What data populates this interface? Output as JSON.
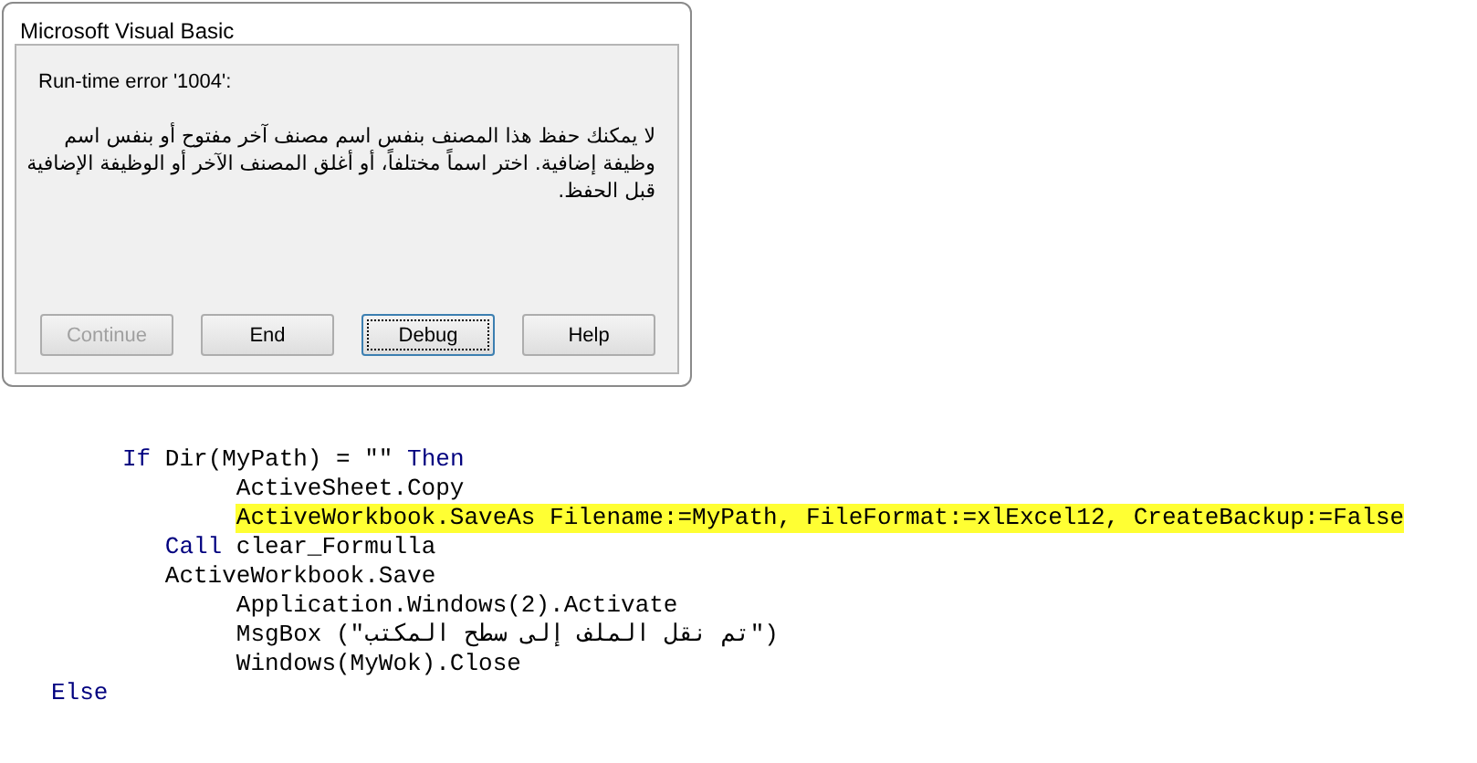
{
  "dialog": {
    "title": "Microsoft Visual Basic",
    "error": "Run-time error '1004':",
    "message": "لا يمكنك حفظ هذا المصنف بنفس اسم مصنف آخر مفتوح أو بنفس اسم وظيفة إضافية. اختر اسماً مختلفاً، أو أغلق المصنف الآخر أو الوظيفة الإضافية قبل الحفظ.",
    "buttons": [
      {
        "label": "Continue",
        "disabled": true,
        "focused": false
      },
      {
        "label": "End",
        "disabled": false,
        "focused": false
      },
      {
        "label": "Debug",
        "disabled": false,
        "focused": true
      },
      {
        "label": "Help",
        "disabled": false,
        "focused": false
      }
    ]
  },
  "code": [
    {
      "highlighted": false,
      "segments": [
        {
          "kind": "keyword",
          "text": "     If"
        },
        {
          "kind": "code",
          "text": " Dir(MyPath) = \"\" "
        },
        {
          "kind": "keyword",
          "text": "Then"
        }
      ]
    },
    {
      "highlighted": false,
      "segments": [
        {
          "kind": "code",
          "text": "             ActiveSheet.Copy"
        }
      ]
    },
    {
      "highlighted": true,
      "segments": [
        {
          "kind": "code",
          "text": "             ActiveWorkbook.SaveAs Filename:=MyPath, FileFormat:=xlExcel12, CreateBackup:=False"
        }
      ]
    },
    {
      "highlighted": false,
      "segments": [
        {
          "kind": "keyword",
          "text": "        Call"
        },
        {
          "kind": "code",
          "text": " clear_Formulla"
        }
      ]
    },
    {
      "highlighted": false,
      "segments": [
        {
          "kind": "code",
          "text": "        ActiveWorkbook.Save"
        }
      ]
    },
    {
      "highlighted": false,
      "segments": [
        {
          "kind": "code",
          "text": "             Application.Windows(2).Activate"
        }
      ]
    },
    {
      "highlighted": false,
      "segments": [
        {
          "kind": "code",
          "text": "             MsgBox (\"تم نقل الملف إلى سطح المكتب\")"
        }
      ]
    },
    {
      "highlighted": false,
      "segments": [
        {
          "kind": "code",
          "text": "             Windows(MyWok).Close"
        }
      ]
    },
    {
      "highlighted": false,
      "segments": [
        {
          "kind": "keyword",
          "text": "Else"
        }
      ]
    }
  ]
}
